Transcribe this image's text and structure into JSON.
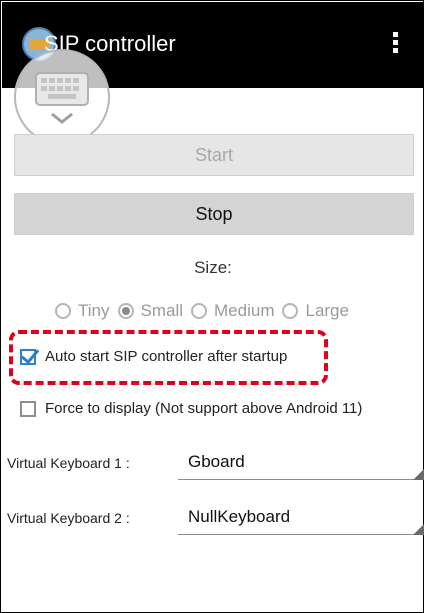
{
  "app": {
    "title": "SIP controller"
  },
  "buttons": {
    "start": "Start",
    "stop": "Stop"
  },
  "size": {
    "label": "Size:",
    "options": [
      {
        "label": "Tiny",
        "checked": false
      },
      {
        "label": "Small",
        "checked": true
      },
      {
        "label": "Medium",
        "checked": false
      },
      {
        "label": "Large",
        "checked": false
      }
    ]
  },
  "checks": {
    "auto_start": {
      "label": "Auto start SIP controller after startup",
      "checked": true
    },
    "force_display": {
      "label": "Force to display (Not support above Android 11)",
      "checked": false
    }
  },
  "keyboards": [
    {
      "label": "Virtual Keyboard 1 :",
      "value": "Gboard"
    },
    {
      "label": "Virtual Keyboard 2 :",
      "value": "NullKeyboard"
    }
  ],
  "colors": {
    "highlight": "#e0001b",
    "checkbox_accent": "#2a83c7",
    "action_bar": "#000000"
  }
}
